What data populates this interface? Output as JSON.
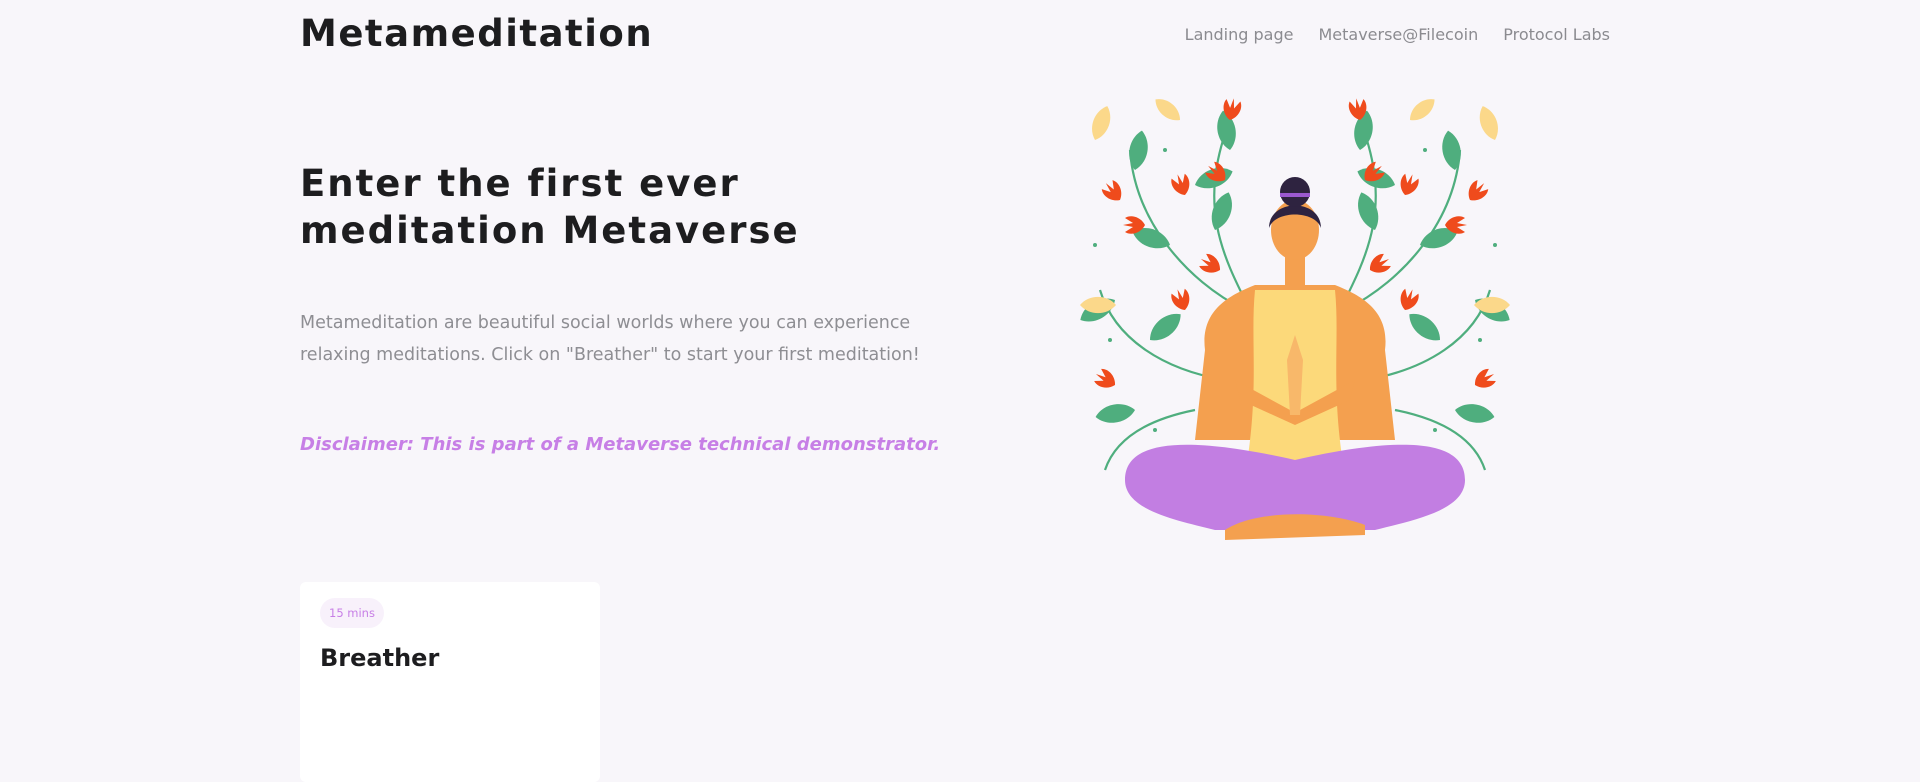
{
  "brand": "Metameditation",
  "nav": [
    {
      "label": "Landing page"
    },
    {
      "label": "Metaverse@Filecoin"
    },
    {
      "label": "Protocol Labs"
    }
  ],
  "hero": {
    "headline": "Enter the first ever meditation Metaverse",
    "description": "Metameditation are beautiful social worlds where you can experience relaxing meditations. Click on \"Breather\" to start your first meditation!",
    "disclaimer": "Disclaimer: This is part of a Metaverse technical demonstrator."
  },
  "cards": [
    {
      "duration": "15 mins",
      "title": "Breather"
    }
  ],
  "colors": {
    "background": "#f8f6fa",
    "accent": "#c77fe6",
    "text": "#1d1d1f",
    "muted": "#8e8e93"
  }
}
